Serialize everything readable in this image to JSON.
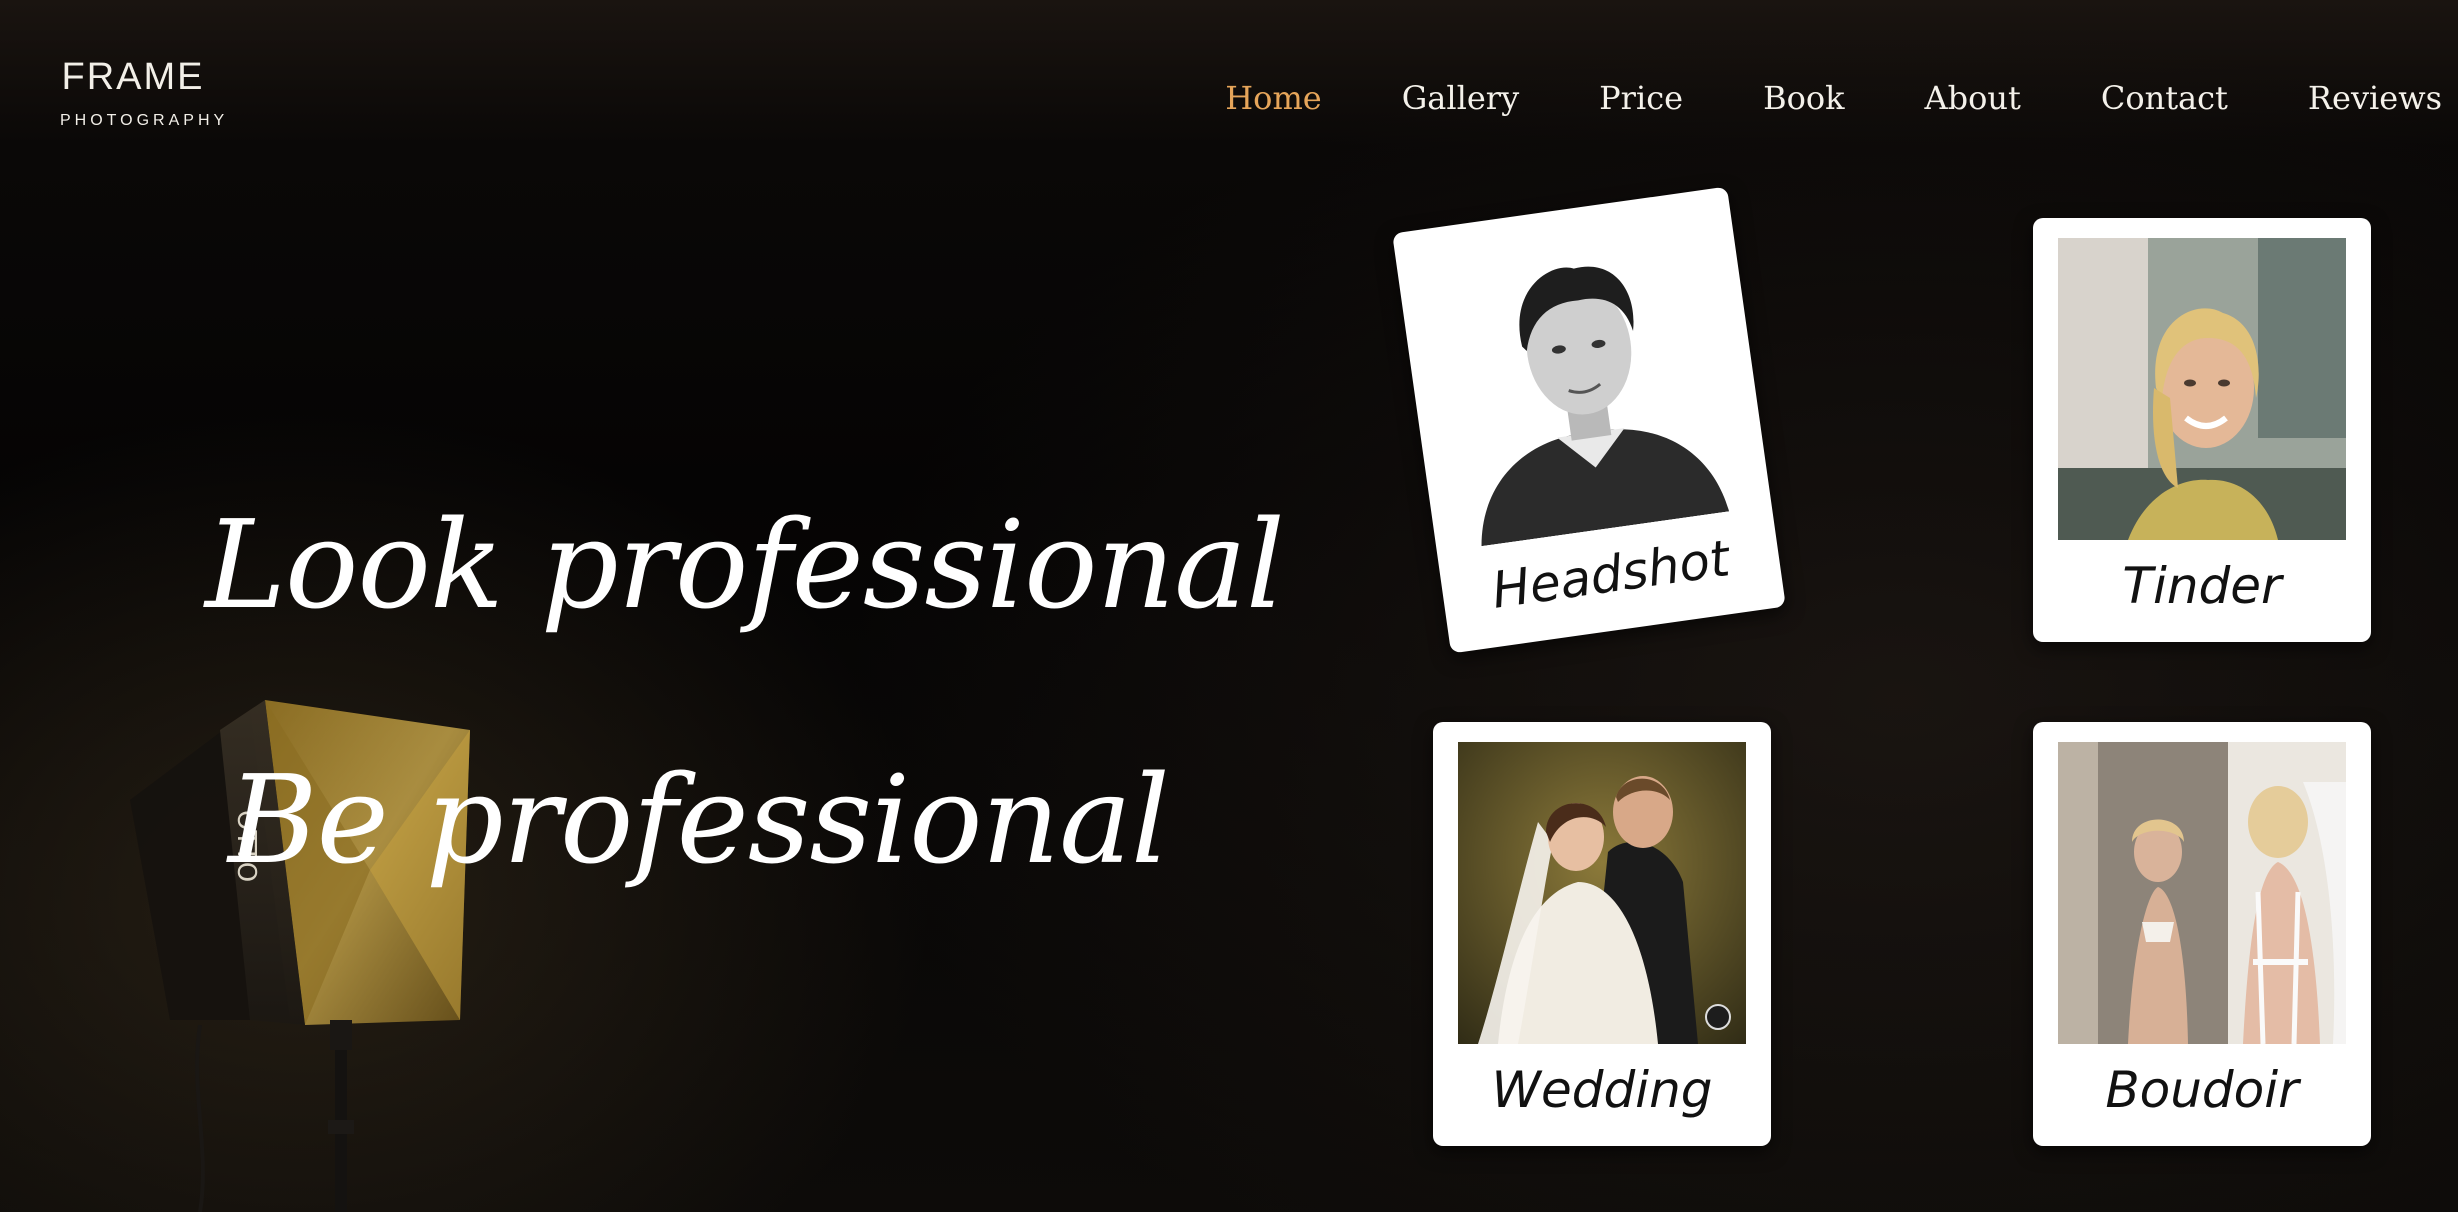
{
  "logo": {
    "main": "FRAME",
    "sub": "PHOTOGRAPHY"
  },
  "nav": {
    "items": [
      {
        "label": "Home",
        "active": true
      },
      {
        "label": "Gallery",
        "active": false
      },
      {
        "label": "Price",
        "active": false
      },
      {
        "label": "Book",
        "active": false
      },
      {
        "label": "About",
        "active": false
      },
      {
        "label": "Contact",
        "active": false
      },
      {
        "label": "Reviews",
        "active": false
      }
    ]
  },
  "hero": {
    "line1": "Look professional",
    "line2": "Be professional"
  },
  "light_brand": "OTTO",
  "cards": [
    {
      "label": "Headshot"
    },
    {
      "label": "Tinder"
    },
    {
      "label": "Wedding"
    },
    {
      "label": "Boudoir"
    }
  ],
  "colors": {
    "nav_active": "#e6a55a",
    "nav_text": "#f4f1ea",
    "background": "#050403",
    "card_bg": "#ffffff"
  }
}
